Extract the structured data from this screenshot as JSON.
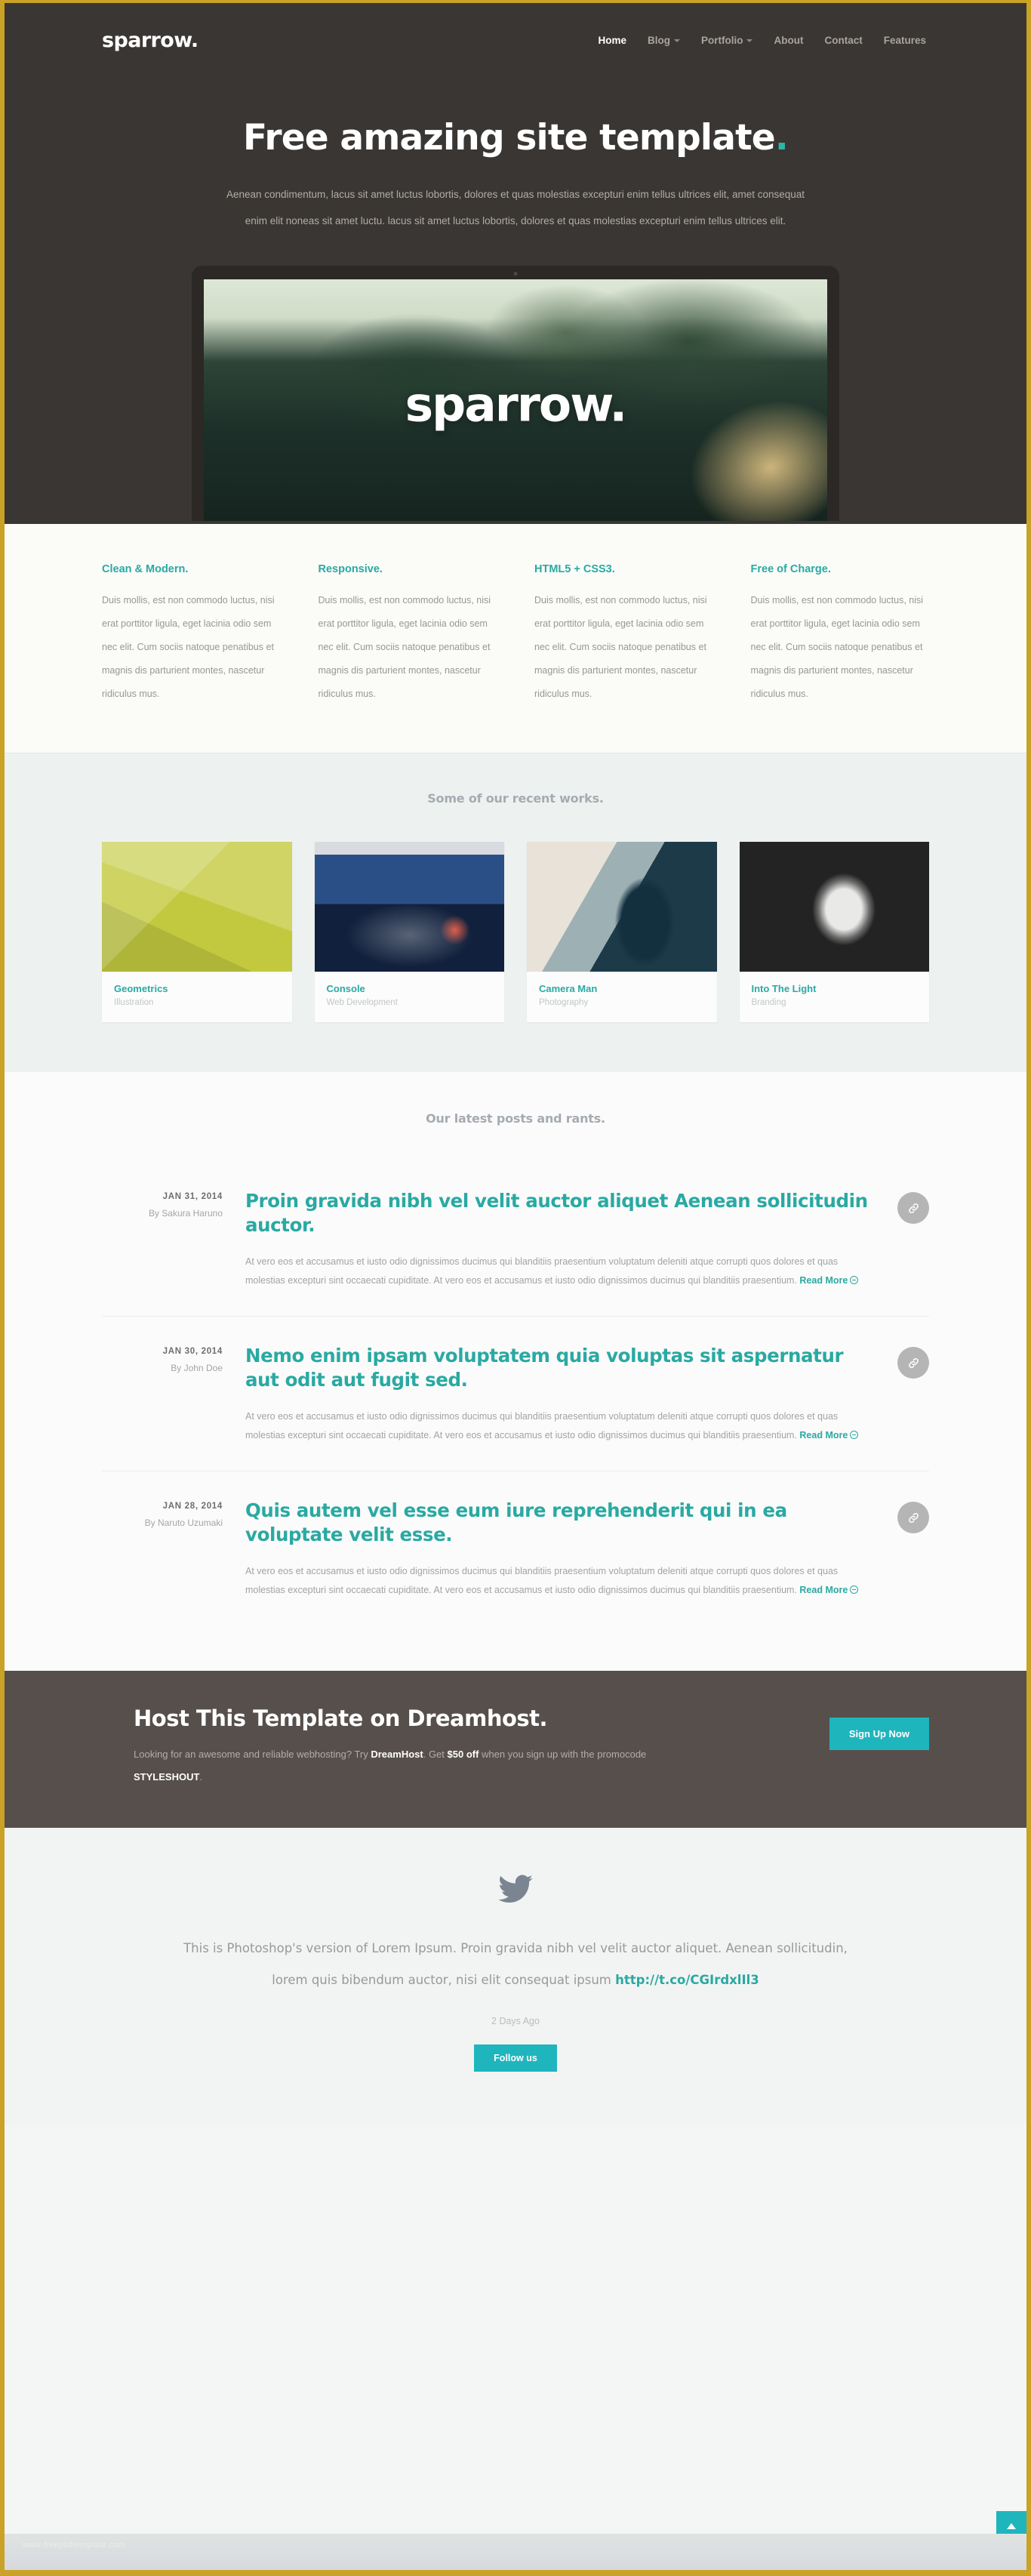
{
  "theme": {
    "accent": "#2aa9a3",
    "accent_button": "#1fb5bd",
    "hero_bg": "#3a3633",
    "cta_bg": "#574f4b",
    "frame": "#c9a227"
  },
  "header": {
    "brand": "sparrow.",
    "nav": [
      {
        "label": "Home",
        "active": true,
        "dropdown": false
      },
      {
        "label": "Blog",
        "active": false,
        "dropdown": true
      },
      {
        "label": "Portfolio",
        "active": false,
        "dropdown": true
      },
      {
        "label": "About",
        "active": false,
        "dropdown": false
      },
      {
        "label": "Contact",
        "active": false,
        "dropdown": false
      },
      {
        "label": "Features",
        "active": false,
        "dropdown": false
      }
    ]
  },
  "hero": {
    "title": "Free amazing site template",
    "title_dot": ".",
    "subtitle": "Aenean condimentum, lacus sit amet luctus lobortis, dolores et quas molestias excepturi enim tellus ultrices elit, amet consequat enim elit noneas sit amet luctu. lacus sit amet luctus lobortis, dolores et quas molestias excepturi enim tellus ultrices elit.",
    "screen_word": "sparrow."
  },
  "features": [
    {
      "title": "Clean & Modern.",
      "body": "Duis mollis, est non commodo luctus, nisi erat porttitor ligula, eget lacinia odio sem nec elit. Cum sociis natoque penatibus et magnis dis parturient montes, nascetur ridiculus mus."
    },
    {
      "title": "Responsive.",
      "body": "Duis mollis, est non commodo luctus, nisi erat porttitor ligula, eget lacinia odio sem nec elit. Cum sociis natoque penatibus et magnis dis parturient montes, nascetur ridiculus mus."
    },
    {
      "title": "HTML5 + CSS3.",
      "body": "Duis mollis, est non commodo luctus, nisi erat porttitor ligula, eget lacinia odio sem nec elit. Cum sociis natoque penatibus et magnis dis parturient montes, nascetur ridiculus mus."
    },
    {
      "title": "Free of Charge.",
      "body": "Duis mollis, est non commodo luctus, nisi erat porttitor ligula, eget lacinia odio sem nec elit. Cum sociis natoque penatibus et magnis dis parturient montes, nascetur ridiculus mus."
    }
  ],
  "portfolio": {
    "heading": "Some of our recent works.",
    "items": [
      {
        "name": "Geometrics",
        "category": "Illustration"
      },
      {
        "name": "Console",
        "category": "Web Development"
      },
      {
        "name": "Camera Man",
        "category": "Photography"
      },
      {
        "name": "Into The Light",
        "category": "Branding"
      }
    ]
  },
  "blog": {
    "heading": "Our latest posts and rants.",
    "read_more": "Read More",
    "posts": [
      {
        "date": "JAN 31, 2014",
        "author": "By Sakura Haruno",
        "title": "Proin gravida nibh vel velit auctor aliquet Aenean sollicitudin auctor.",
        "excerpt": "At vero eos et accusamus et iusto odio dignissimos ducimus qui blanditiis praesentium voluptatum deleniti atque corrupti quos dolores et quas molestias excepturi sint occaecati cupiditate. At vero eos et accusamus et iusto odio dignissimos ducimus qui blanditiis praesentium."
      },
      {
        "date": "JAN 30, 2014",
        "author": "By John Doe",
        "title": "Nemo enim ipsam voluptatem quia voluptas sit aspernatur aut odit aut fugit sed.",
        "excerpt": "At vero eos et accusamus et iusto odio dignissimos ducimus qui blanditiis praesentium voluptatum deleniti atque corrupti quos dolores et quas molestias excepturi sint occaecati cupiditate. At vero eos et accusamus et iusto odio dignissimos ducimus qui blanditiis praesentium."
      },
      {
        "date": "JAN 28, 2014",
        "author": "By Naruto Uzumaki",
        "title": "Quis autem vel esse eum iure reprehenderit qui in ea voluptate velit esse.",
        "excerpt": "At vero eos et accusamus et iusto odio dignissimos ducimus qui blanditiis praesentium voluptatum deleniti atque corrupti quos dolores et quas molestias excepturi sint occaecati cupiditate. At vero eos et accusamus et iusto odio dignissimos ducimus qui blanditiis praesentium."
      }
    ]
  },
  "cta": {
    "title": "Host This Template on Dreamhost.",
    "text_1": "Looking for an awesome and reliable webhosting? Try ",
    "brand": "DreamHost",
    "text_2": ". Get ",
    "discount": "$50 off",
    "text_3": " when you sign up with the promocode ",
    "promocode": "STYLESHOUT",
    "text_4": ".",
    "button": "Sign Up Now"
  },
  "footer": {
    "icon": "twitter-icon",
    "text_before": "This is Photoshop's version of Lorem Ipsum. Proin gravida nibh vel velit auctor aliquet. Aenean sollicitudin, lorem quis bibendum auctor, nisi elit consequat ipsum ",
    "link": "http://t.co/CGIrdxlIl3",
    "timestamp": "2 Days Ago",
    "button": "Follow us",
    "watermark": "www.freepsdtemplate.com"
  }
}
